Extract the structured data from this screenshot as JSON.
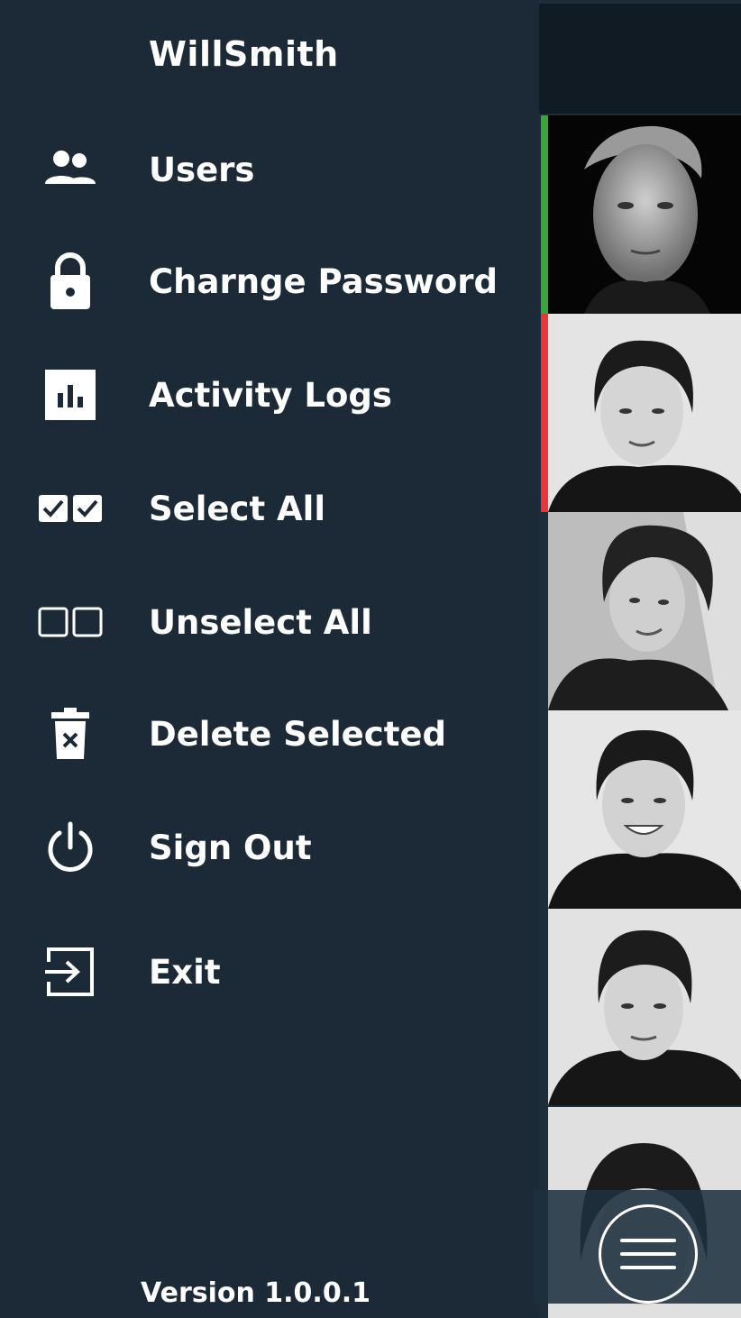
{
  "drawer": {
    "username": "WillSmith",
    "menu": [
      {
        "label": "Users",
        "icon": "users-icon"
      },
      {
        "label": "Charnge Password",
        "icon": "lock-icon"
      },
      {
        "label": "Activity Logs",
        "icon": "bar-chart-icon"
      },
      {
        "label": "Select All",
        "icon": "checkboxes-checked-icon"
      },
      {
        "label": "Unselect All",
        "icon": "checkboxes-empty-icon"
      },
      {
        "label": "Delete Selected",
        "icon": "trash-icon"
      },
      {
        "label": "Sign Out",
        "icon": "power-icon"
      },
      {
        "label": "Exit",
        "icon": "exit-icon"
      }
    ],
    "version": "Version 1.0.0.1"
  },
  "gallery": {
    "photos": [
      {
        "status_color": "#3aa53a",
        "style": "black-background portrait"
      },
      {
        "status_color": "#e03a3a",
        "style": "grey portrait"
      },
      {
        "status_color": "",
        "style": "grey portrait"
      },
      {
        "status_color": "",
        "style": "grey portrait"
      },
      {
        "status_color": "",
        "style": "grey portrait"
      },
      {
        "status_color": "",
        "style": "grey portrait (partially hidden)"
      }
    ],
    "fab_icon": "hamburger-menu-icon"
  },
  "colors": {
    "drawer_bg": "#1c2a38",
    "header_bg": "#101b23",
    "status_green": "#3aa53a",
    "status_red": "#e03a3a"
  }
}
